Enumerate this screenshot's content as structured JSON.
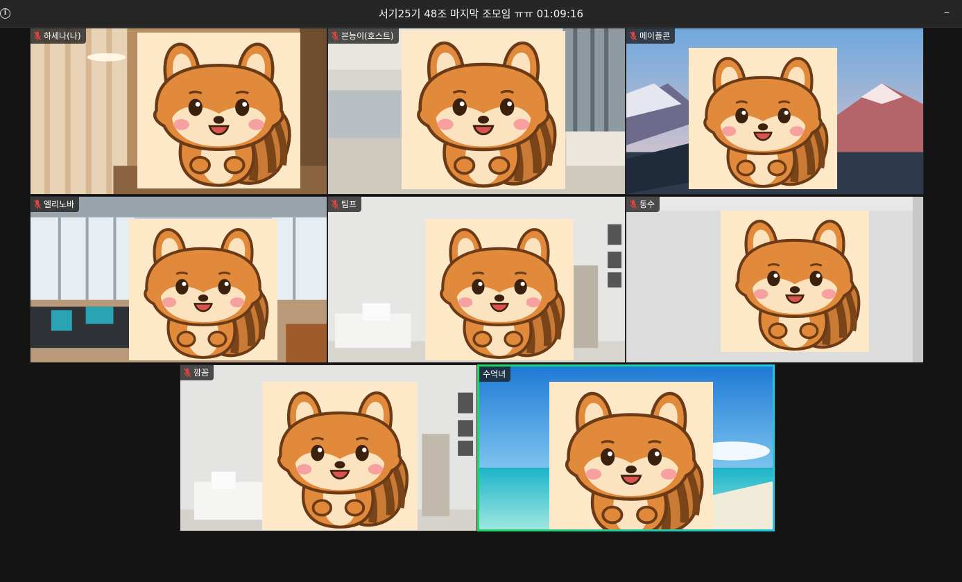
{
  "window": {
    "title": "서기25기 48조 마지막 조모임 ㅠㅠ 01:09:16",
    "info_icon": "info-icon",
    "minimize_label": "–"
  },
  "participants": [
    {
      "name": "하세나(나)",
      "muted": true,
      "background": "warm-room"
    },
    {
      "name": "본능이(호스트)",
      "muted": true,
      "background": "lobby"
    },
    {
      "name": "메이플콘",
      "muted": true,
      "background": "mountains"
    },
    {
      "name": "엘리노바",
      "muted": true,
      "background": "office-sofa"
    },
    {
      "name": "팀프",
      "muted": true,
      "background": "white-room"
    },
    {
      "name": "동수",
      "muted": true,
      "background": "plain-wall"
    },
    {
      "name": "깜꼼",
      "muted": true,
      "background": "white-room"
    },
    {
      "name": "수억녀",
      "muted": false,
      "background": "beach",
      "speaking": true
    }
  ],
  "colors": {
    "speaking_border_start": "#1ed760",
    "speaking_border_end": "#1ec8e0",
    "muted_icon": "#e0443e",
    "avatar_bg": "#fde9c8"
  }
}
